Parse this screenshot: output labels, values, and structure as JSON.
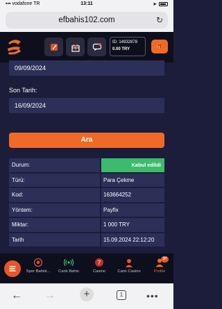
{
  "status_bar": {
    "carrier": "vodafone TR",
    "time": "13:11"
  },
  "browser": {
    "url": "efbahis102.com",
    "tab_count": "1"
  },
  "header": {
    "account_id": "ID: 14932878",
    "balance": "0.00 TRY"
  },
  "filter": {
    "start_date_value": "09/09/2024",
    "end_date_label": "Son Tarih:",
    "end_date_value": "16/09/2024",
    "search_label": "Ara"
  },
  "transaction": {
    "rows": [
      {
        "key": "Durum:",
        "value": "Kabul edildi"
      },
      {
        "key": "Türü:",
        "value": "Para Çekme"
      },
      {
        "key": "Kod:",
        "value": "163664252"
      },
      {
        "key": "Yöntem:",
        "value": "Payfix"
      },
      {
        "key": "Miktar:",
        "value": "1 000 TRY"
      },
      {
        "key": "Tarih",
        "value": "15.09.2024 22:12:20"
      }
    ]
  },
  "tabbar": {
    "items": [
      {
        "label": "Spor Bahisl..."
      },
      {
        "label": "Canlı Bahis"
      },
      {
        "label": "Casino"
      },
      {
        "label": "Canlı Casino"
      },
      {
        "label": "Profile"
      }
    ],
    "profile_badge": "37"
  },
  "colors": {
    "accent": "#f06a26",
    "success": "#3dbb6d",
    "panel": "#2c2f58",
    "background": "#1b1d3a"
  }
}
